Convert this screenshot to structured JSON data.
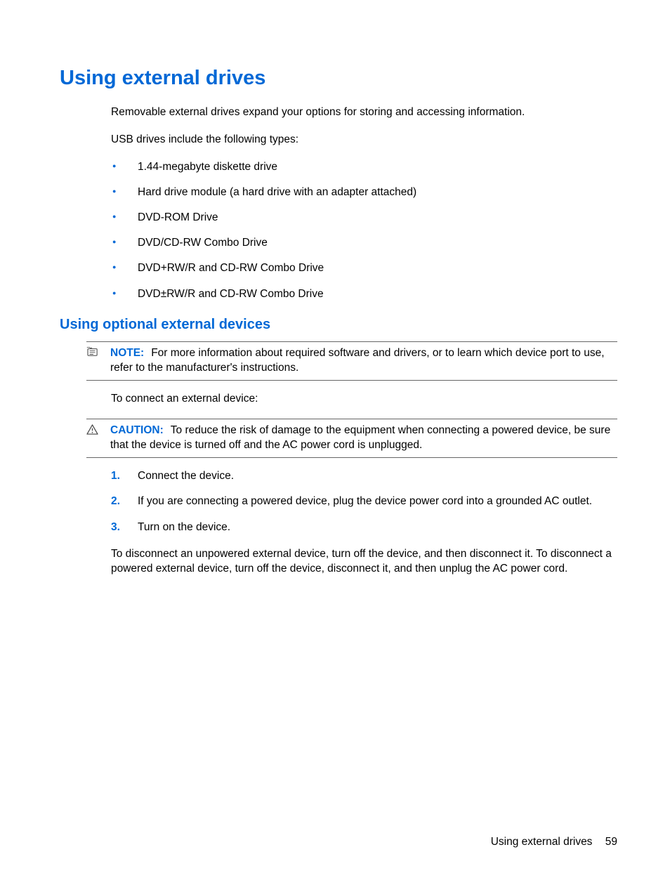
{
  "heading1": "Using external drives",
  "intro1": "Removable external drives expand your options for storing and accessing information.",
  "intro2": "USB drives include the following types:",
  "bullets": [
    "1.44-megabyte diskette drive",
    "Hard drive module (a hard drive with an adapter attached)",
    "DVD-ROM Drive",
    "DVD/CD-RW Combo Drive",
    "DVD+RW/R and CD-RW Combo Drive",
    "DVD±RW/R and CD-RW Combo Drive"
  ],
  "heading2": "Using optional external devices",
  "note": {
    "label": "NOTE:",
    "text": "For more information about required software and drivers, or to learn which device port to use, refer to the manufacturer's instructions."
  },
  "connectIntro": "To connect an external device:",
  "caution": {
    "label": "CAUTION:",
    "text": "To reduce the risk of damage to the equipment when connecting a powered device, be sure that the device is turned off and the AC power cord is unplugged."
  },
  "steps": [
    "Connect the device.",
    "If you are connecting a powered device, plug the device power cord into a grounded AC outlet.",
    "Turn on the device."
  ],
  "disconnectPara": "To disconnect an unpowered external device, turn off the device, and then disconnect it. To disconnect a powered external device, turn off the device, disconnect it, and then unplug the AC power cord.",
  "footer": {
    "section": "Using external drives",
    "page": "59"
  }
}
